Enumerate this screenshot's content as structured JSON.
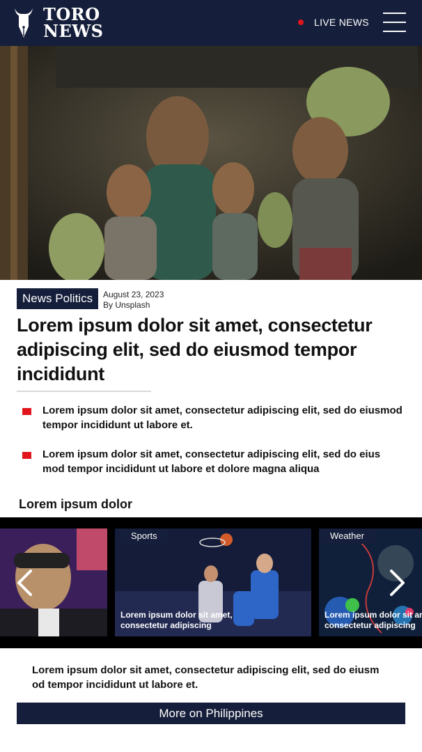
{
  "header": {
    "logo_line1": "TORO",
    "logo_line2": "NEWS",
    "live_label": "LIVE NEWS",
    "menu_icon": "hamburger-menu-icon",
    "live_dot_color": "#e0161c",
    "brand_color": "#151e3a"
  },
  "article": {
    "category": "News Politics",
    "date": "August 23, 2023",
    "byline": "By Unsplash",
    "title": "Lorem ipsum dolor sit amet, consectetur adipiscing elit, sed do eiusmod tempor incididunt",
    "bullets": [
      "Lorem ipsum dolor sit amet, consectetur adipiscing elit, sed do eiusmod tempor incididunt ut labore et.",
      "Lorem ipsum dolor sit amet, consectetur adipiscing elit, sed do eius mod tempor incididunt ut labore et dolore magna aliqua"
    ]
  },
  "related": {
    "section_title": "Lorem ipsum dolor",
    "cards": [
      {
        "category": "",
        "caption": ""
      },
      {
        "category": "Sports",
        "caption": "Lorem ipsum dolor sit amet,\nconsectetur adipiscing"
      },
      {
        "category": "Weather",
        "caption": "Lorem ipsum dolor sit amet,\nconsectetur adipiscing"
      }
    ],
    "prev_icon": "chevron-left-icon",
    "next_icon": "chevron-right-icon",
    "summary": "Lorem ipsum dolor sit amet, consectetur adipiscing elit, sed do eiusm od tempor incididunt ut labore et.",
    "more_button": "More on Philippines"
  }
}
